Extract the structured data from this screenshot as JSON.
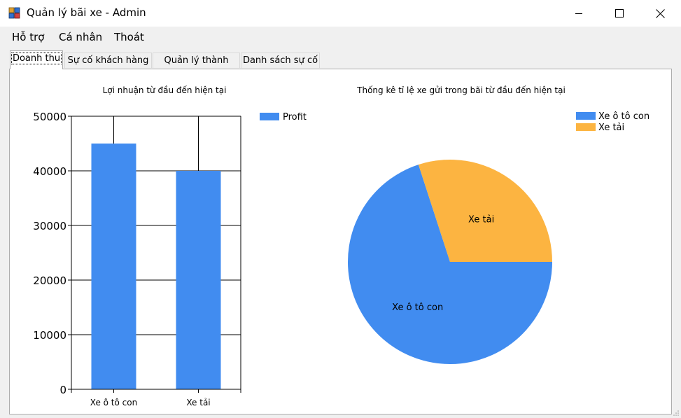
{
  "window": {
    "title": "Quản lý bãi xe - Admin",
    "icons": [
      "app-icon",
      "minimize-icon",
      "maximize-icon",
      "close-icon"
    ]
  },
  "menu": {
    "items": [
      "Hỗ trợ",
      "Cá nhân",
      "Thoát"
    ]
  },
  "tabs": [
    {
      "label": "Doanh thu",
      "active": true
    },
    {
      "label": "Sự cố khách hàng",
      "active": false
    },
    {
      "label": "Quản lý thành viên",
      "active": false
    },
    {
      "label": "Danh sách sự cố",
      "active": false
    }
  ],
  "chart_data": [
    {
      "type": "bar",
      "title": "Lợi nhuận từ đầu đến hiện tại",
      "categories": [
        "Xe ô tô con",
        "Xe tải"
      ],
      "series": [
        {
          "name": "Profit",
          "values": [
            45000,
            40000
          ],
          "color": "#418cf0"
        }
      ],
      "ylim": [
        0,
        50000
      ],
      "yticks": [
        "0",
        "10000",
        "20000",
        "30000",
        "40000",
        "50000"
      ],
      "grid": true,
      "legend": "right"
    },
    {
      "type": "pie",
      "title": "Thống kê tỉ lệ xe gửi trong bãi từ đầu đến hiện tại",
      "labels": [
        "Xe ô tô con",
        "Xe tải"
      ],
      "values": [
        70,
        30
      ],
      "colors": [
        "#418cf0",
        "#fcb441"
      ],
      "legend": "top-right"
    }
  ]
}
